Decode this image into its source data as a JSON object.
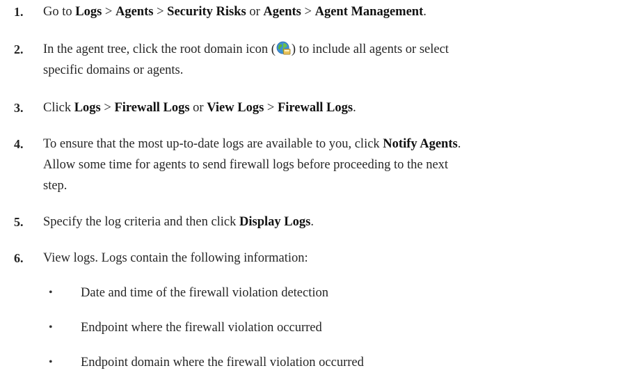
{
  "steps": [
    {
      "num": "1.",
      "parts": [
        "Go to ",
        "Logs",
        " > ",
        "Agents",
        " > ",
        "Security Risks",
        " or ",
        "Agents",
        " > ",
        "Agent Management",
        "."
      ]
    },
    {
      "num": "2.",
      "line1_a": "In the agent tree, click the root domain icon (",
      "line1_b": ") to include all agents or select",
      "line2": "specific domains or agents."
    },
    {
      "num": "3.",
      "parts": [
        "Click ",
        "Logs",
        " > ",
        "Firewall Logs",
        " or ",
        "View Logs",
        " > ",
        "Firewall Logs",
        "."
      ]
    },
    {
      "num": "4.",
      "line1_a": "To ensure that the most up-to-date logs are available to you, click ",
      "line1_bold": "Notify Agents",
      "line1_b": ".",
      "line2": "Allow some time for agents to send firewall logs before proceeding to the next",
      "line3": "step."
    },
    {
      "num": "5.",
      "parts": [
        "Specify the log criteria and then click ",
        "Display Logs",
        "."
      ]
    },
    {
      "num": "6.",
      "text": "View logs. Logs contain the following information:"
    }
  ],
  "bullets": [
    {
      "dot": "•",
      "text": "Date and time of the firewall violation detection"
    },
    {
      "dot": "•",
      "text": "Endpoint where the firewall violation occurred"
    },
    {
      "dot": "•",
      "text": "Endpoint domain where the firewall violation occurred"
    }
  ],
  "icons": {
    "root_domain": "globe-network-icon"
  }
}
